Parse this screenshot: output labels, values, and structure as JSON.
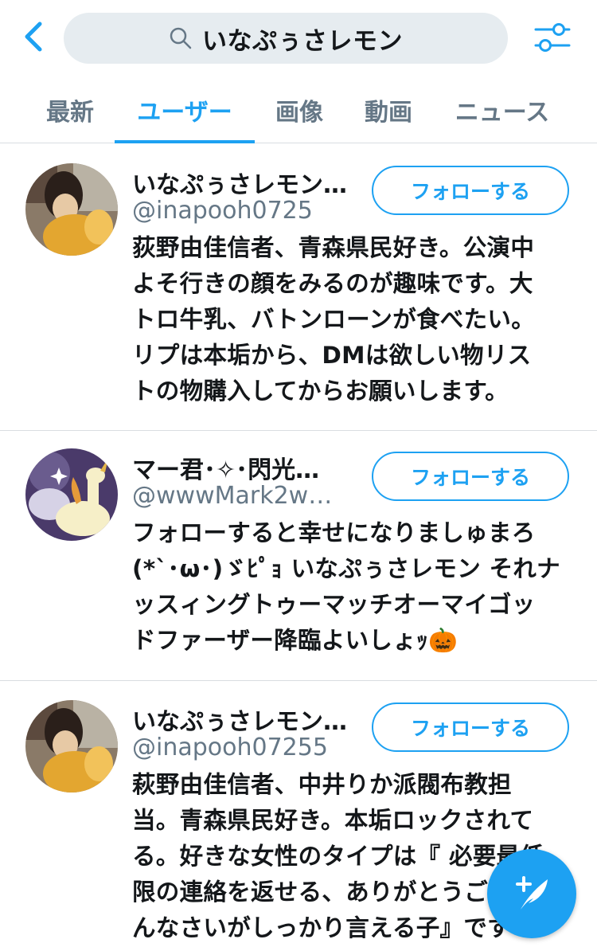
{
  "header": {
    "search_query": "いなぷぅさレモン",
    "icons": {
      "back": "chevron-left-icon",
      "search": "search-icon",
      "filter": "sliders-icon"
    }
  },
  "tabs": [
    {
      "label": "最新",
      "active": false
    },
    {
      "label": "ユーザー",
      "active": true
    },
    {
      "label": "画像",
      "active": false
    },
    {
      "label": "動画",
      "active": false
    },
    {
      "label": "ニュース",
      "active": false
    }
  ],
  "users": [
    {
      "name": "いなぷぅさレモン…",
      "handle": "@inapooh0725",
      "follow_label": "フォローする",
      "bio_lines": [
        "荻野由佳信者、青森県民好き。公演中",
        "よそ行きの顔をみるのが趣味です。大",
        "トロ牛乳、バトンローンが食べたい。",
        "リプは本垢から、DMは欲しい物リス",
        "トの物購入してからお願いします。"
      ]
    },
    {
      "name": "マー君･✧･閃光…",
      "handle": "@wwwMark2w…",
      "follow_label": "フォローする",
      "bio_lines": [
        "フォローすると幸せになりましゅまろ",
        "(*`･ω･)ゞﾋﾟｮ いなぷぅさレモン それナ",
        "ッスィングトゥーマッチオーマイゴッ",
        "ドファーザー降臨よいしょｯ🎃"
      ]
    },
    {
      "name": "いなぷぅさレモン…",
      "handle": "@inapooh07255",
      "follow_label": "フォローする",
      "bio_lines": [
        "萩野由佳信者、中井りか派閥布教担",
        "当。青森県民好き。本垢ロックされて",
        "る。好きな女性のタイプは『 必要最低",
        "限の連絡を返せる、ありがとうごめ",
        "んなさいがしっかり言える子』です"
      ]
    }
  ],
  "compose": {
    "icon": "compose-tweet-icon"
  },
  "colors": {
    "accent": "#1da1f2",
    "text": "#14171a",
    "secondary": "#657786",
    "divider": "#d9dde1",
    "search_bg": "#e6ecf0"
  }
}
